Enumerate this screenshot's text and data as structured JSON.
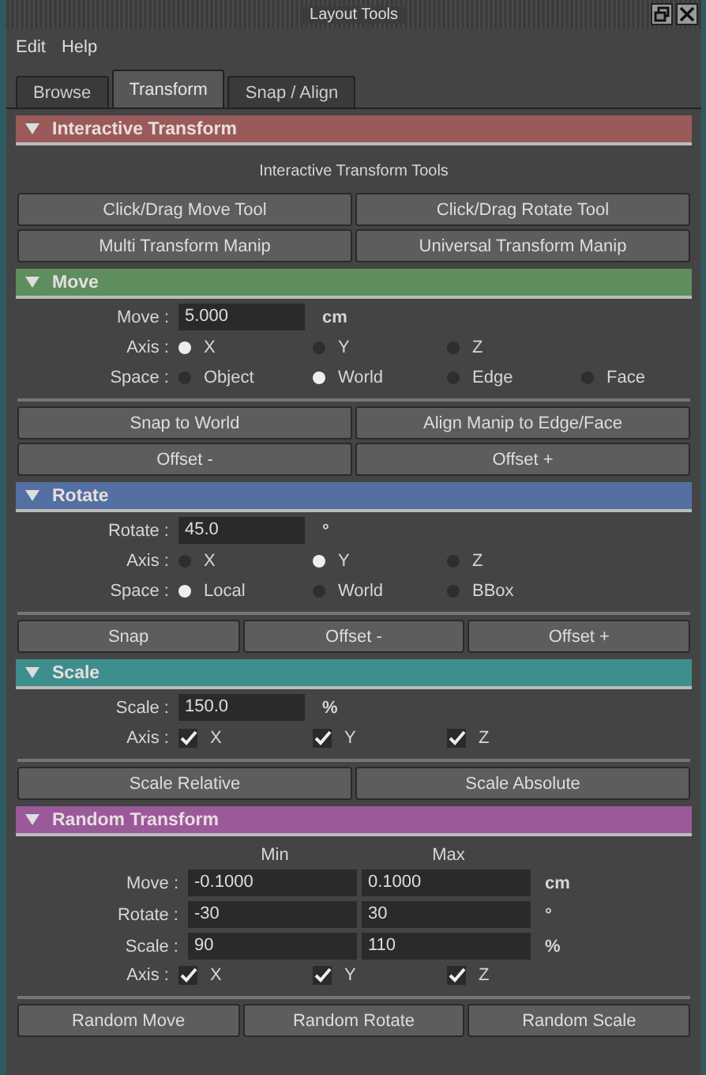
{
  "window": {
    "title": "Layout Tools"
  },
  "menu": [
    "Edit",
    "Help"
  ],
  "tabs": [
    {
      "label": "Browse",
      "selected": false
    },
    {
      "label": "Transform",
      "selected": true
    },
    {
      "label": "Snap / Align",
      "selected": false
    }
  ],
  "sections": [
    {
      "title": "Interactive Transform",
      "color": "#9b5a5a",
      "expanded": true,
      "items": [
        {
          "kind": "caption",
          "text": "Interactive Transform Tools"
        },
        {
          "kind": "buttons",
          "labels": [
            "Click/Drag Move Tool",
            "Click/Drag Rotate Tool"
          ]
        },
        {
          "kind": "buttons",
          "labels": [
            "Multi Transform Manip",
            "Universal Transform Manip"
          ]
        }
      ]
    },
    {
      "title": "Move",
      "color": "#5e8e5e",
      "expanded": true,
      "items": [
        {
          "kind": "field",
          "label": "Move :",
          "value": "5.000",
          "unit": "cm"
        },
        {
          "kind": "radio",
          "label": "Axis :",
          "options": [
            {
              "label": "X",
              "selected": true
            },
            {
              "label": "Y",
              "selected": false
            },
            {
              "label": "Z",
              "selected": false
            }
          ]
        },
        {
          "kind": "radio",
          "label": "Space :",
          "options": [
            {
              "label": "Object",
              "selected": false
            },
            {
              "label": "World",
              "selected": true
            },
            {
              "label": "Edge",
              "selected": false
            },
            {
              "label": "Face",
              "selected": false
            }
          ]
        },
        {
          "kind": "buttons",
          "labels": [
            "Snap to World",
            "Align Manip to Edge/Face"
          ]
        },
        {
          "kind": "buttons",
          "labels": [
            "Offset -",
            "Offset +"
          ]
        }
      ]
    },
    {
      "title": "Rotate",
      "color": "#5470a2",
      "expanded": true,
      "items": [
        {
          "kind": "field",
          "label": "Rotate :",
          "value": "45.0",
          "unit": "°"
        },
        {
          "kind": "radio",
          "label": "Axis :",
          "options": [
            {
              "label": "X",
              "selected": false
            },
            {
              "label": "Y",
              "selected": true
            },
            {
              "label": "Z",
              "selected": false
            }
          ]
        },
        {
          "kind": "radio",
          "label": "Space :",
          "options": [
            {
              "label": "Local",
              "selected": true
            },
            {
              "label": "World",
              "selected": false
            },
            {
              "label": "BBox",
              "selected": false
            }
          ]
        },
        {
          "kind": "buttons",
          "labels": [
            "Snap",
            "Offset -",
            "Offset +"
          ]
        }
      ]
    },
    {
      "title": "Scale",
      "color": "#3f8e8e",
      "expanded": true,
      "items": [
        {
          "kind": "field",
          "label": "Scale :",
          "value": "150.0",
          "unit": "%"
        },
        {
          "kind": "check",
          "label": "Axis :",
          "options": [
            {
              "label": "X",
              "checked": true
            },
            {
              "label": "Y",
              "checked": true
            },
            {
              "label": "Z",
              "checked": true
            }
          ]
        },
        {
          "kind": "buttons",
          "labels": [
            "Scale Relative",
            "Scale Absolute"
          ]
        }
      ]
    },
    {
      "title": "Random Transform",
      "color": "#9a5a9a",
      "expanded": true,
      "items": [
        {
          "kind": "minmax",
          "columns": [
            "Min",
            "Max"
          ],
          "rows": [
            {
              "label": "Move :",
              "min": "-0.1000",
              "max": "0.1000",
              "unit": "cm"
            },
            {
              "label": "Rotate :",
              "min": "-30",
              "max": "30",
              "unit": "°"
            },
            {
              "label": "Scale :",
              "min": "90",
              "max": "110",
              "unit": "%"
            }
          ]
        },
        {
          "kind": "check",
          "label": "Axis :",
          "options": [
            {
              "label": "X",
              "checked": true
            },
            {
              "label": "Y",
              "checked": true
            },
            {
              "label": "Z",
              "checked": true
            }
          ]
        },
        {
          "kind": "buttons",
          "labels": [
            "Random Move",
            "Random Rotate",
            "Random Scale"
          ]
        }
      ]
    }
  ]
}
